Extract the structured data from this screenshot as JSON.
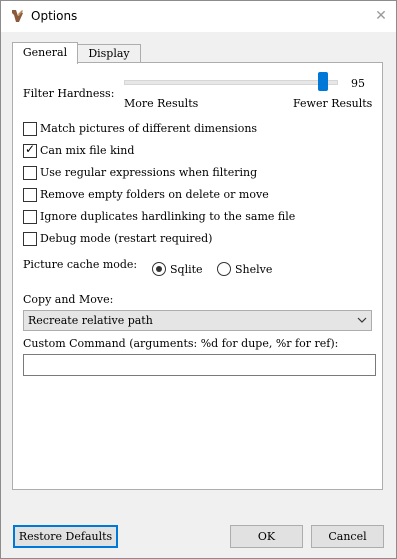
{
  "window": {
    "title": "Options",
    "close_glyph": "✕"
  },
  "tabs": [
    {
      "label": "General",
      "active": true
    },
    {
      "label": "Display",
      "active": false
    }
  ],
  "filter": {
    "label": "Filter Hardness:",
    "value": "95",
    "value_fraction": 0.95,
    "min_label": "More Results",
    "max_label": "Fewer Results"
  },
  "checkboxes": [
    {
      "label": "Match pictures of different dimensions",
      "checked": false
    },
    {
      "label": "Can mix file kind",
      "checked": true
    },
    {
      "label": "Use regular expressions when filtering",
      "checked": false
    },
    {
      "label": "Remove empty folders on delete or move",
      "checked": false
    },
    {
      "label": "Ignore duplicates hardlinking to the same file",
      "checked": false
    },
    {
      "label": "Debug mode (restart required)",
      "checked": false
    }
  ],
  "cache": {
    "label": "Picture cache mode:",
    "options": [
      {
        "label": "Sqlite",
        "selected": true
      },
      {
        "label": "Shelve",
        "selected": false
      }
    ]
  },
  "copy_move": {
    "label": "Copy and Move:",
    "value": "Recreate relative path"
  },
  "custom_command": {
    "label": "Custom Command (arguments: %d for dupe, %r for ref):",
    "value": ""
  },
  "buttons": {
    "restore": "Restore Defaults",
    "ok": "OK",
    "cancel": "Cancel"
  },
  "colors": {
    "accent": "#0078d7",
    "icon_brown": "#8a5a3a"
  }
}
